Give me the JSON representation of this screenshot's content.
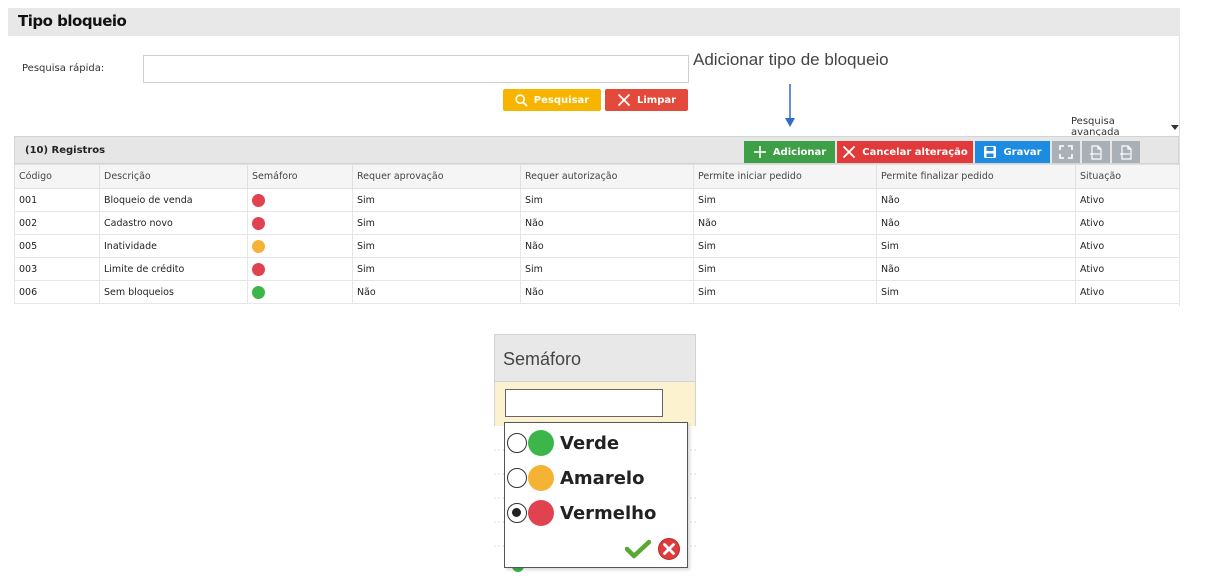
{
  "page": {
    "title": "Tipo bloqueio"
  },
  "search": {
    "quick_label": "Pesquisa rápida:",
    "quick_value": "",
    "search_button": "Pesquisar",
    "clear_button": "Limpar",
    "advanced_label": "Pesquisa avançada"
  },
  "annotation": {
    "text": "Adicionar tipo de bloqueio"
  },
  "grid": {
    "records_label": "(10) Registros",
    "toolbar": {
      "add": "Adicionar",
      "cancel": "Cancelar alteração",
      "save": "Gravar",
      "export_csv_icon": "csv-export-icon",
      "export_xls_icon": "xls-export-icon",
      "expand_icon": "expand-icon"
    },
    "columns": [
      "Código",
      "Descrição",
      "Semáforo",
      "Requer aprovação",
      "Requer autorização",
      "Permite iniciar pedido",
      "Permite finalizar pedido",
      "Situação"
    ],
    "rows": [
      {
        "codigo": "001",
        "descricao": "Bloqueio de venda",
        "semaforo": "red",
        "aprovacao": "Sim",
        "autorizacao": "Sim",
        "iniciar": "Sim",
        "finalizar": "Não",
        "situacao": "Ativo"
      },
      {
        "codigo": "002",
        "descricao": "Cadastro novo",
        "semaforo": "red",
        "aprovacao": "Sim",
        "autorizacao": "Não",
        "iniciar": "Não",
        "finalizar": "Não",
        "situacao": "Ativo"
      },
      {
        "codigo": "005",
        "descricao": "Inatividade",
        "semaforo": "yellow",
        "aprovacao": "Sim",
        "autorizacao": "Não",
        "iniciar": "Sim",
        "finalizar": "Sim",
        "situacao": "Ativo"
      },
      {
        "codigo": "003",
        "descricao": "Limite de crédito",
        "semaforo": "red",
        "aprovacao": "Sim",
        "autorizacao": "Sim",
        "iniciar": "Sim",
        "finalizar": "Não",
        "situacao": "Ativo"
      },
      {
        "codigo": "006",
        "descricao": "Sem bloqueios",
        "semaforo": "green",
        "aprovacao": "Não",
        "autorizacao": "Não",
        "iniciar": "Sim",
        "finalizar": "Sim",
        "situacao": "Ativo"
      }
    ]
  },
  "semaforo_filter": {
    "header": "Semáforo",
    "input_value": "",
    "options": [
      {
        "label": "Verde",
        "color": "green",
        "checked": false
      },
      {
        "label": "Amarelo",
        "color": "yellow",
        "checked": false
      },
      {
        "label": "Vermelho",
        "color": "red",
        "checked": true
      }
    ],
    "confirm_icon": "checkmark-icon",
    "cancel_icon": "cancel-circle-icon"
  },
  "colors": {
    "red": "#e0424f",
    "yellow": "#f5b335",
    "green": "#3cb54a",
    "btn_search": "#f7b500",
    "btn_clear": "#e34a3c",
    "btn_add": "#3ea046",
    "btn_cancel": "#e03a3a",
    "btn_save": "#1d8ce0",
    "arrow": "#2e6ec2"
  }
}
